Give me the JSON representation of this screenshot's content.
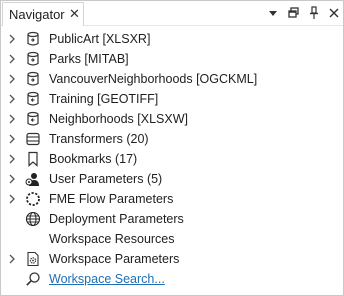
{
  "header": {
    "title": "Navigator",
    "close_glyph": "✕",
    "buttons": [
      "dropdown-arrow-icon",
      "restore-window-icon",
      "pin-icon",
      "close-panel-icon"
    ]
  },
  "tree": {
    "items": [
      {
        "label": "PublicArt [XLSXR]",
        "icon": "reader-dataset-icon",
        "expandable": true
      },
      {
        "label": "Parks [MITAB]",
        "icon": "reader-dataset-icon",
        "expandable": true
      },
      {
        "label": "VancouverNeighborhoods [OGCKML]",
        "icon": "reader-dataset-icon",
        "expandable": true
      },
      {
        "label": "Training [GEOTIFF]",
        "icon": "writer-dataset-icon",
        "expandable": true
      },
      {
        "label": "Neighborhoods [XLSXW]",
        "icon": "writer-dataset-icon",
        "expandable": true
      },
      {
        "label": "Transformers (20)",
        "icon": "transformers-icon",
        "expandable": true
      },
      {
        "label": "Bookmarks (17)",
        "icon": "bookmark-icon",
        "expandable": true
      },
      {
        "label": "User Parameters (5)",
        "icon": "user-parameters-icon",
        "expandable": true
      },
      {
        "label": "FME Flow Parameters",
        "icon": "flow-parameters-icon",
        "expandable": true
      },
      {
        "label": "Deployment Parameters",
        "icon": "globe-icon",
        "expandable": false
      },
      {
        "label": "Workspace Resources",
        "icon": "blank-icon",
        "expandable": false
      },
      {
        "label": "Workspace Parameters",
        "icon": "gear-icon",
        "expandable": true
      },
      {
        "label": "Workspace Search...",
        "icon": "search-icon",
        "expandable": false,
        "link": true
      }
    ]
  },
  "colors": {
    "link": "#1f6fb5",
    "text": "#1e1e1e",
    "border": "#c8c8c8"
  }
}
